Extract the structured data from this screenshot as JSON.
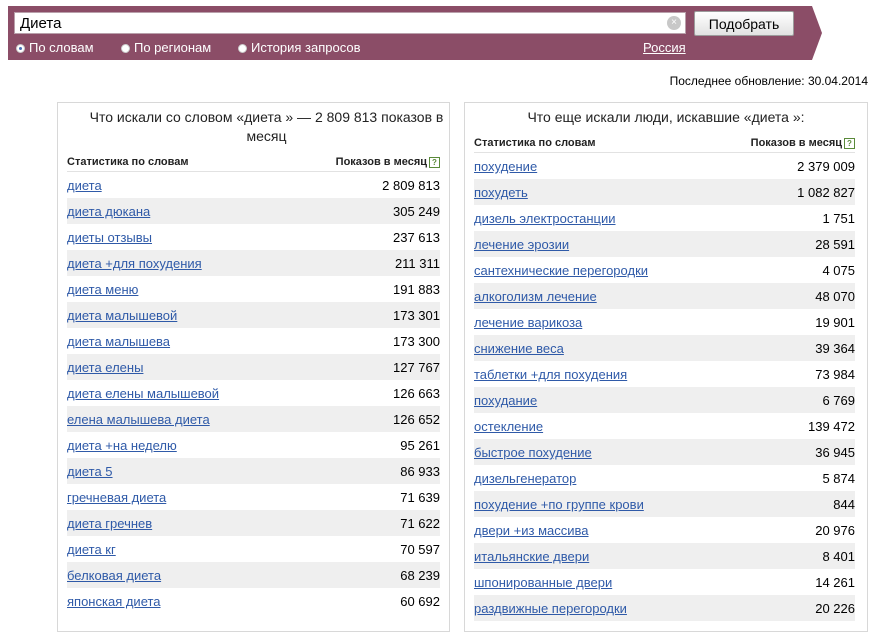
{
  "search": {
    "value": "Диета",
    "button_label": "Подобрать",
    "clear_icon": "×",
    "radios": [
      {
        "label": "По словам",
        "selected": true
      },
      {
        "label": "По регионам",
        "selected": false
      },
      {
        "label": "История запросов",
        "selected": false
      }
    ],
    "region": "Россия"
  },
  "colors": {
    "header": "#8b4d67",
    "link": "#2f5aa8",
    "stripe": "#efefef"
  },
  "updated": "Последнее обновление: 30.04.2014",
  "left": {
    "title": "Что искали со словом «диета » — 2 809 813 показов в месяц",
    "col_keyword": "Статистика по словам",
    "col_count": "Показов в месяц",
    "help": "?",
    "rows": [
      {
        "kw": "диета",
        "count": "2 809 813"
      },
      {
        "kw": "диета дюкана",
        "count": "305 249"
      },
      {
        "kw": "диеты отзывы",
        "count": "237 613"
      },
      {
        "kw": "диета +для похудения",
        "count": "211 311"
      },
      {
        "kw": "диета меню",
        "count": "191 883"
      },
      {
        "kw": "диета малышевой",
        "count": "173 301"
      },
      {
        "kw": "диета малышева",
        "count": "173 300"
      },
      {
        "kw": "диета елены",
        "count": "127 767"
      },
      {
        "kw": "диета елены малышевой",
        "count": "126 663"
      },
      {
        "kw": "елена малышева диета",
        "count": "126 652"
      },
      {
        "kw": "диета +на неделю",
        "count": "95 261"
      },
      {
        "kw": "диета 5",
        "count": "86 933"
      },
      {
        "kw": "гречневая диета",
        "count": "71 639"
      },
      {
        "kw": "диета гречнев",
        "count": "71 622"
      },
      {
        "kw": "диета кг",
        "count": "70 597"
      },
      {
        "kw": "белковая диета",
        "count": "68 239"
      },
      {
        "kw": "японская диета",
        "count": "60 692"
      }
    ]
  },
  "right": {
    "title": "Что еще искали люди, искавшие «диета »:",
    "col_keyword": "Статистика по словам",
    "col_count": "Показов в месяц",
    "help": "?",
    "rows": [
      {
        "kw": "похудение",
        "count": "2 379 009"
      },
      {
        "kw": "похудеть",
        "count": "1 082 827"
      },
      {
        "kw": "дизель электростанции",
        "count": "1 751"
      },
      {
        "kw": "лечение эрозии",
        "count": "28 591"
      },
      {
        "kw": "сантехнические перегородки",
        "count": "4 075"
      },
      {
        "kw": "алкоголизм лечение",
        "count": "48 070"
      },
      {
        "kw": "лечение варикоза",
        "count": "19 901"
      },
      {
        "kw": "снижение веса",
        "count": "39 364"
      },
      {
        "kw": "таблетки +для похудения",
        "count": "73 984"
      },
      {
        "kw": "похудание",
        "count": "6 769"
      },
      {
        "kw": "остекление",
        "count": "139 472"
      },
      {
        "kw": "быстрое похудение",
        "count": "36 945"
      },
      {
        "kw": "дизельгенератор",
        "count": "5 874"
      },
      {
        "kw": "похудение +по группе крови",
        "count": "844"
      },
      {
        "kw": "двери +из массива",
        "count": "20 976"
      },
      {
        "kw": "итальянские двери",
        "count": "8 401"
      },
      {
        "kw": "шпонированные двери",
        "count": "14 261"
      },
      {
        "kw": "раздвижные перегородки",
        "count": "20 226"
      }
    ]
  }
}
